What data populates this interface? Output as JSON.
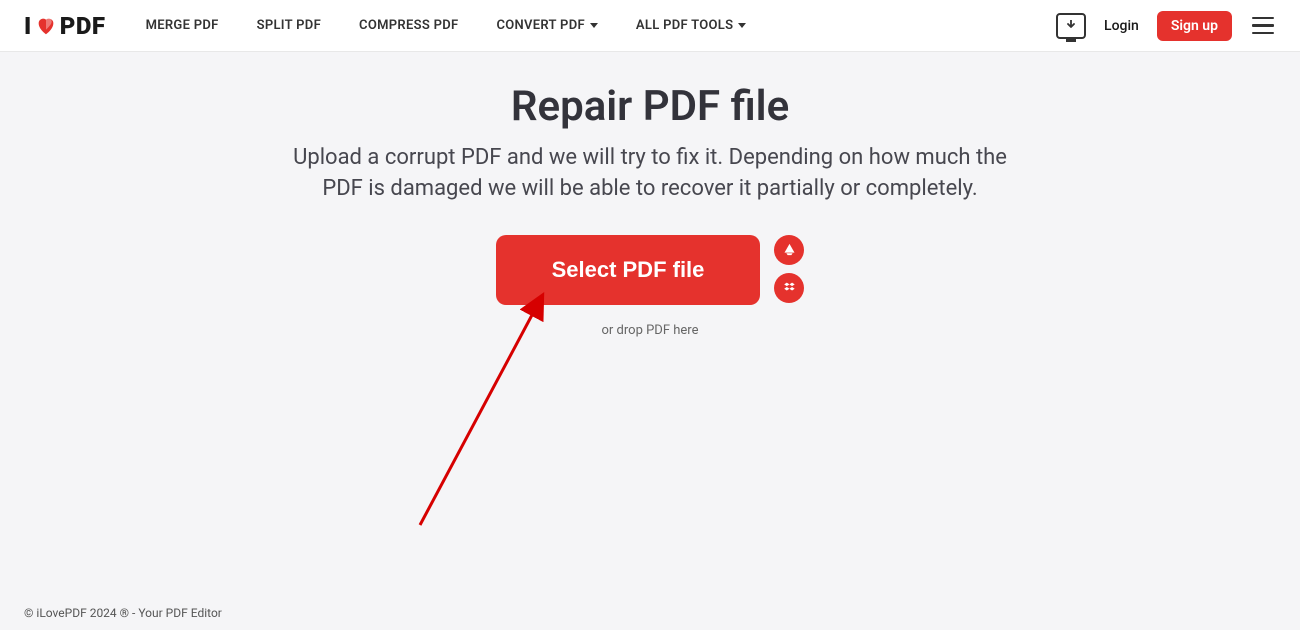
{
  "brand": {
    "prefix": "I",
    "suffix": "PDF"
  },
  "nav": {
    "merge": "MERGE PDF",
    "split": "SPLIT PDF",
    "compress": "COMPRESS PDF",
    "convert": "CONVERT PDF",
    "all": "ALL PDF TOOLS"
  },
  "actions": {
    "login": "Login",
    "signup": "Sign up"
  },
  "main": {
    "title": "Repair PDF file",
    "subtitle": "Upload a corrupt PDF and we will try to fix it. Depending on how much the PDF is damaged we will be able to recover it partially or completely.",
    "select_button": "Select PDF file",
    "drop_hint": "or drop PDF here"
  },
  "footer": {
    "text": "© iLovePDF 2024 ® - Your PDF Editor"
  },
  "colors": {
    "accent": "#e5322d"
  }
}
